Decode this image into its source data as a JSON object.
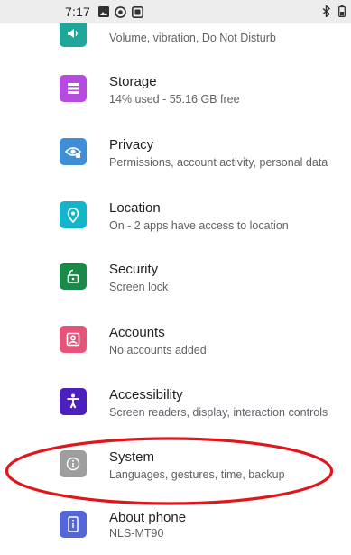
{
  "status_bar": {
    "time": "7:17",
    "left_icons": [
      "image-icon",
      "location-circle-icon",
      "app-square-icon"
    ],
    "right_icons": [
      "bluetooth-icon",
      "battery-icon"
    ]
  },
  "settings": [
    {
      "title": "",
      "subtitle": "Volume, vibration, Do Not Disturb",
      "icon": "sound-icon",
      "color": "#1fa79a"
    },
    {
      "title": "Storage",
      "subtitle": "14% used - 55.16 GB free",
      "icon": "storage-icon",
      "color": "#b64be0"
    },
    {
      "title": "Privacy",
      "subtitle": "Permissions, account activity, personal data",
      "icon": "privacy-eye-icon",
      "color": "#3f8fd8"
    },
    {
      "title": "Location",
      "subtitle": "On - 2 apps have access to location",
      "icon": "location-pin-icon",
      "color": "#14b5ca"
    },
    {
      "title": "Security",
      "subtitle": "Screen lock",
      "icon": "lock-icon",
      "color": "#1a8a4a"
    },
    {
      "title": "Accounts",
      "subtitle": "No accounts added",
      "icon": "account-box-icon",
      "color": "#e5557a"
    },
    {
      "title": "Accessibility",
      "subtitle": "Screen readers, display, interaction controls",
      "icon": "accessibility-icon",
      "color": "#4c1fbf"
    },
    {
      "title": "System",
      "subtitle": "Languages, gestures, time, backup",
      "icon": "info-icon",
      "color": "#9e9e9e"
    },
    {
      "title": "About phone",
      "subtitle": "NLS-MT90",
      "icon": "about-phone-icon",
      "color": "#5567d6"
    }
  ],
  "annotation": {
    "color": "#e0161b",
    "highlighted_item": "System"
  }
}
